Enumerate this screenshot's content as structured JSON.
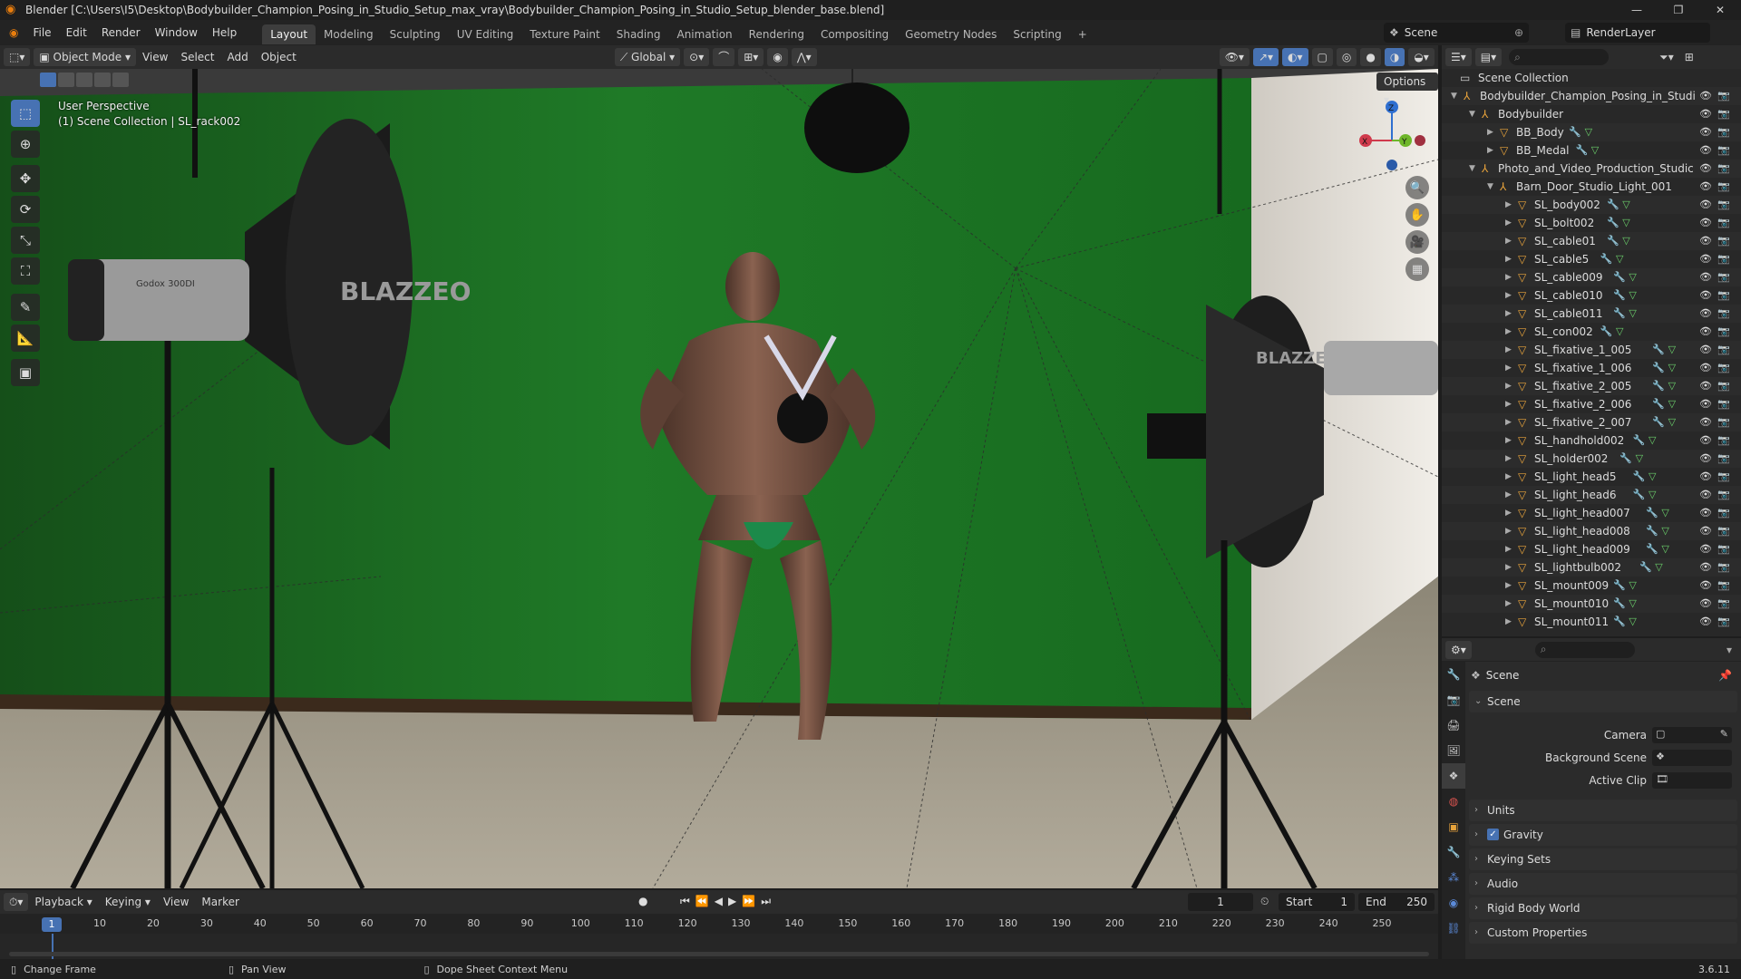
{
  "window": {
    "title": "Blender [C:\\Users\\I5\\Desktop\\Bodybuilder_Champion_Posing_in_Studio_Setup_max_vray\\Bodybuilder_Champion_Posing_in_Studio_Setup_blender_base.blend]"
  },
  "menu": [
    "File",
    "Edit",
    "Render",
    "Window",
    "Help"
  ],
  "workspaces": [
    "Layout",
    "Modeling",
    "Sculpting",
    "UV Editing",
    "Texture Paint",
    "Shading",
    "Animation",
    "Rendering",
    "Compositing",
    "Geometry Nodes",
    "Scripting"
  ],
  "active_workspace": "Layout",
  "scene_name": "Scene",
  "view_layer": "RenderLayer",
  "viewport_header": {
    "mode": "Object Mode",
    "menus": [
      "View",
      "Select",
      "Add",
      "Object"
    ],
    "transform_orientation": "Global",
    "options_label": "Options"
  },
  "viewport": {
    "perspective": "User Perspective",
    "collection_info": "(1) Scene Collection | SL_rack002",
    "softbox_brand": "BLAZZEO",
    "light_model": "Godox 300DI"
  },
  "gizmo": {
    "x": "X",
    "y": "Y",
    "z": "Z"
  },
  "outliner": {
    "root": "Scene Collection",
    "rows": [
      {
        "label": "Bodybuilder_Champion_Posing_in_Studi",
        "level": 1,
        "type": "collection",
        "expanded": true
      },
      {
        "label": "Bodybuilder",
        "level": 2,
        "type": "collection",
        "expanded": true
      },
      {
        "label": "BB_Body",
        "level": 3,
        "type": "mesh",
        "expanded": false
      },
      {
        "label": "BB_Medal",
        "level": 3,
        "type": "mesh",
        "expanded": false
      },
      {
        "label": "Photo_and_Video_Production_Studic",
        "level": 2,
        "type": "collection",
        "expanded": true
      },
      {
        "label": "Barn_Door_Studio_Light_001",
        "level": 3,
        "type": "collection",
        "expanded": true
      },
      {
        "label": "SL_body002",
        "level": 4,
        "type": "mesh",
        "expanded": false
      },
      {
        "label": "SL_bolt002",
        "level": 4,
        "type": "mesh",
        "expanded": false
      },
      {
        "label": "SL_cable01",
        "level": 4,
        "type": "mesh",
        "expanded": false
      },
      {
        "label": "SL_cable5",
        "level": 4,
        "type": "mesh",
        "expanded": false
      },
      {
        "label": "SL_cable009",
        "level": 4,
        "type": "mesh",
        "expanded": false
      },
      {
        "label": "SL_cable010",
        "level": 4,
        "type": "mesh",
        "expanded": false
      },
      {
        "label": "SL_cable011",
        "level": 4,
        "type": "mesh",
        "expanded": false
      },
      {
        "label": "SL_con002",
        "level": 4,
        "type": "mesh",
        "expanded": false
      },
      {
        "label": "SL_fixative_1_005",
        "level": 4,
        "type": "mesh",
        "expanded": false
      },
      {
        "label": "SL_fixative_1_006",
        "level": 4,
        "type": "mesh",
        "expanded": false
      },
      {
        "label": "SL_fixative_2_005",
        "level": 4,
        "type": "mesh",
        "expanded": false
      },
      {
        "label": "SL_fixative_2_006",
        "level": 4,
        "type": "mesh",
        "expanded": false
      },
      {
        "label": "SL_fixative_2_007",
        "level": 4,
        "type": "mesh",
        "expanded": false
      },
      {
        "label": "SL_handhold002",
        "level": 4,
        "type": "mesh",
        "expanded": false
      },
      {
        "label": "SL_holder002",
        "level": 4,
        "type": "mesh",
        "expanded": false
      },
      {
        "label": "SL_light_head5",
        "level": 4,
        "type": "mesh",
        "expanded": false
      },
      {
        "label": "SL_light_head6",
        "level": 4,
        "type": "mesh",
        "expanded": false
      },
      {
        "label": "SL_light_head007",
        "level": 4,
        "type": "mesh",
        "expanded": false
      },
      {
        "label": "SL_light_head008",
        "level": 4,
        "type": "mesh",
        "expanded": false
      },
      {
        "label": "SL_light_head009",
        "level": 4,
        "type": "mesh",
        "expanded": false
      },
      {
        "label": "SL_lightbulb002",
        "level": 4,
        "type": "mesh",
        "expanded": false
      },
      {
        "label": "SL_mount009",
        "level": 4,
        "type": "mesh",
        "expanded": false
      },
      {
        "label": "SL_mount010",
        "level": 4,
        "type": "mesh",
        "expanded": false
      },
      {
        "label": "SL_mount011",
        "level": 4,
        "type": "mesh",
        "expanded": false
      }
    ]
  },
  "properties": {
    "context": "Scene",
    "section": "Scene",
    "fields": [
      {
        "label": "Camera"
      },
      {
        "label": "Background Scene"
      },
      {
        "label": "Active Clip"
      }
    ],
    "panels": [
      "Units",
      "Gravity",
      "Keying Sets",
      "Audio",
      "Rigid Body World",
      "Custom Properties"
    ],
    "gravity_enabled": true
  },
  "timeline": {
    "menus": [
      "Playback",
      "Keying",
      "View",
      "Marker"
    ],
    "current_frame": "1",
    "start_label": "Start",
    "start": "1",
    "end_label": "End",
    "end": "250",
    "ticks": [
      10,
      20,
      30,
      40,
      50,
      60,
      70,
      80,
      90,
      100,
      110,
      120,
      130,
      140,
      150,
      160,
      170,
      180,
      190,
      200,
      210,
      220,
      230,
      240,
      250
    ]
  },
  "statusbar": {
    "hint1": "Change Frame",
    "hint2": "Pan View",
    "hint3": "Dope Sheet Context Menu",
    "version": "3.6.11"
  },
  "colors": {
    "accent": "#4772b3",
    "green_screen": "#1d6b22",
    "brand_orange": "#e87d0d"
  }
}
